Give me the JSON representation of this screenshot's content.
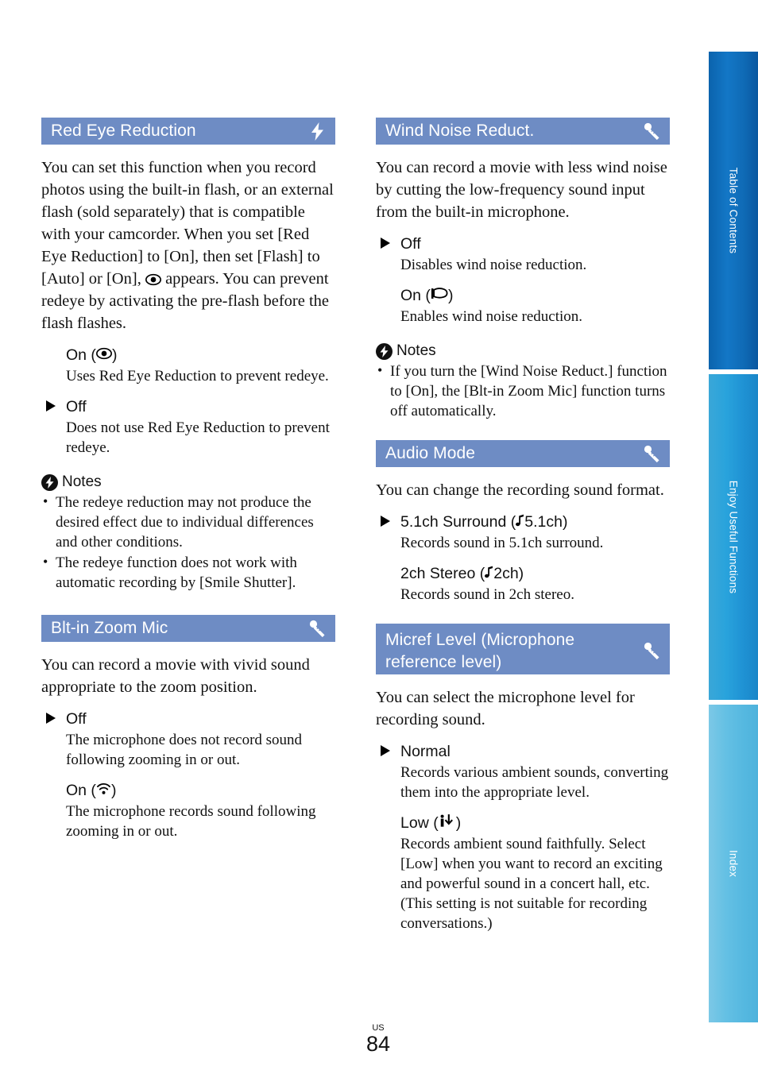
{
  "page": {
    "region_code": "US",
    "number": "84"
  },
  "colors": {
    "section_header_bg": "#6e8cc4",
    "tab_toc": "#0f6ab5",
    "tab_enjoy": "#1f92d4",
    "tab_index": "#55b8e0",
    "text": "#111111"
  },
  "rail": {
    "tabs": [
      {
        "label": "Table of Contents",
        "name": "table-of-contents"
      },
      {
        "label": "Enjoy Useful Functions",
        "name": "enjoy-useful-functions"
      },
      {
        "label": "Index",
        "name": "index"
      }
    ]
  },
  "left_column": {
    "sections": [
      {
        "title": "Red Eye Reduction",
        "icon": "flash-icon",
        "intro": "You can set this function when you record photos using the built-in flash, or an external flash (sold separately) that is compatible with your camcorder.\nWhen you set [Red Eye Reduction] to [On], then set [Flash] to [Auto] or [On], ",
        "intro_tail": " appears. You can prevent redeye by activating the pre-flash before the flash flashes.",
        "options": [
          {
            "label": "On (",
            "label_tail": ")",
            "icon": "redeye-icon",
            "marker": false,
            "desc": "Uses Red Eye Reduction to prevent redeye."
          },
          {
            "label": "Off",
            "label_tail": "",
            "icon": "",
            "marker": true,
            "desc": "Does not use Red Eye Reduction to prevent redeye."
          }
        ],
        "notes_label": "Notes",
        "notes": [
          "The redeye reduction may not produce the desired effect due to individual differences and other conditions.",
          "The redeye function does not work with automatic recording by [Smile Shutter]."
        ]
      },
      {
        "title": "Blt-in Zoom Mic",
        "icon": "microphone-icon",
        "intro": "You can record a movie with vivid sound appropriate to the zoom position.",
        "intro_tail": "",
        "options": [
          {
            "label": "Off",
            "label_tail": "",
            "icon": "",
            "marker": true,
            "desc": "The microphone does not record sound following zooming in or out."
          },
          {
            "label": "On (",
            "label_tail": ")",
            "icon": "zoom-mic-icon",
            "marker": false,
            "desc": "The microphone records sound following zooming in or out."
          }
        ],
        "notes_label": "",
        "notes": []
      }
    ]
  },
  "right_column": {
    "sections": [
      {
        "title": "Wind Noise Reduct.",
        "icon": "microphone-icon",
        "intro": "You can record a movie with less wind noise by cutting the low-frequency sound input from the built-in microphone.",
        "intro_tail": "",
        "options": [
          {
            "label": "Off",
            "label_tail": "",
            "icon": "",
            "marker": true,
            "desc": "Disables wind noise reduction."
          },
          {
            "label": "On (",
            "label_tail": ")",
            "icon": "wind-flag-icon",
            "marker": false,
            "desc": "Enables wind noise reduction."
          }
        ],
        "notes_label": "Notes",
        "notes": [
          "If you turn the [Wind Noise Reduct.] function to [On], the [Blt-in Zoom Mic] function turns off automatically."
        ]
      },
      {
        "title": "Audio Mode",
        "icon": "microphone-icon",
        "intro": "You can change the recording sound format.",
        "intro_tail": "",
        "options": [
          {
            "label": "5.1ch Surround (",
            "label_tail": "5.1ch)",
            "icon": "music-note-icon",
            "marker": true,
            "desc": "Records sound in 5.1ch surround."
          },
          {
            "label": "2ch Stereo (",
            "label_tail": "2ch)",
            "icon": "music-note-icon",
            "marker": false,
            "desc": "Records sound in 2ch stereo."
          }
        ],
        "notes_label": "",
        "notes": []
      },
      {
        "title": "Micref Level (Microphone\nreference level)",
        "icon": "microphone-icon",
        "intro": "You can select the microphone level for recording sound.",
        "intro_tail": "",
        "options": [
          {
            "label": "Normal",
            "label_tail": "",
            "icon": "",
            "marker": true,
            "desc": "Records various ambient sounds, converting them into the appropriate level."
          },
          {
            "label": "Low (",
            "label_tail": ")",
            "icon": "mic-low-icon",
            "marker": false,
            "desc": "Records ambient sound faithfully. Select [Low] when you want to record an exciting and powerful sound in a concert hall, etc. (This setting is not suitable for recording conversations.)"
          }
        ],
        "notes_label": "",
        "notes": []
      }
    ]
  }
}
